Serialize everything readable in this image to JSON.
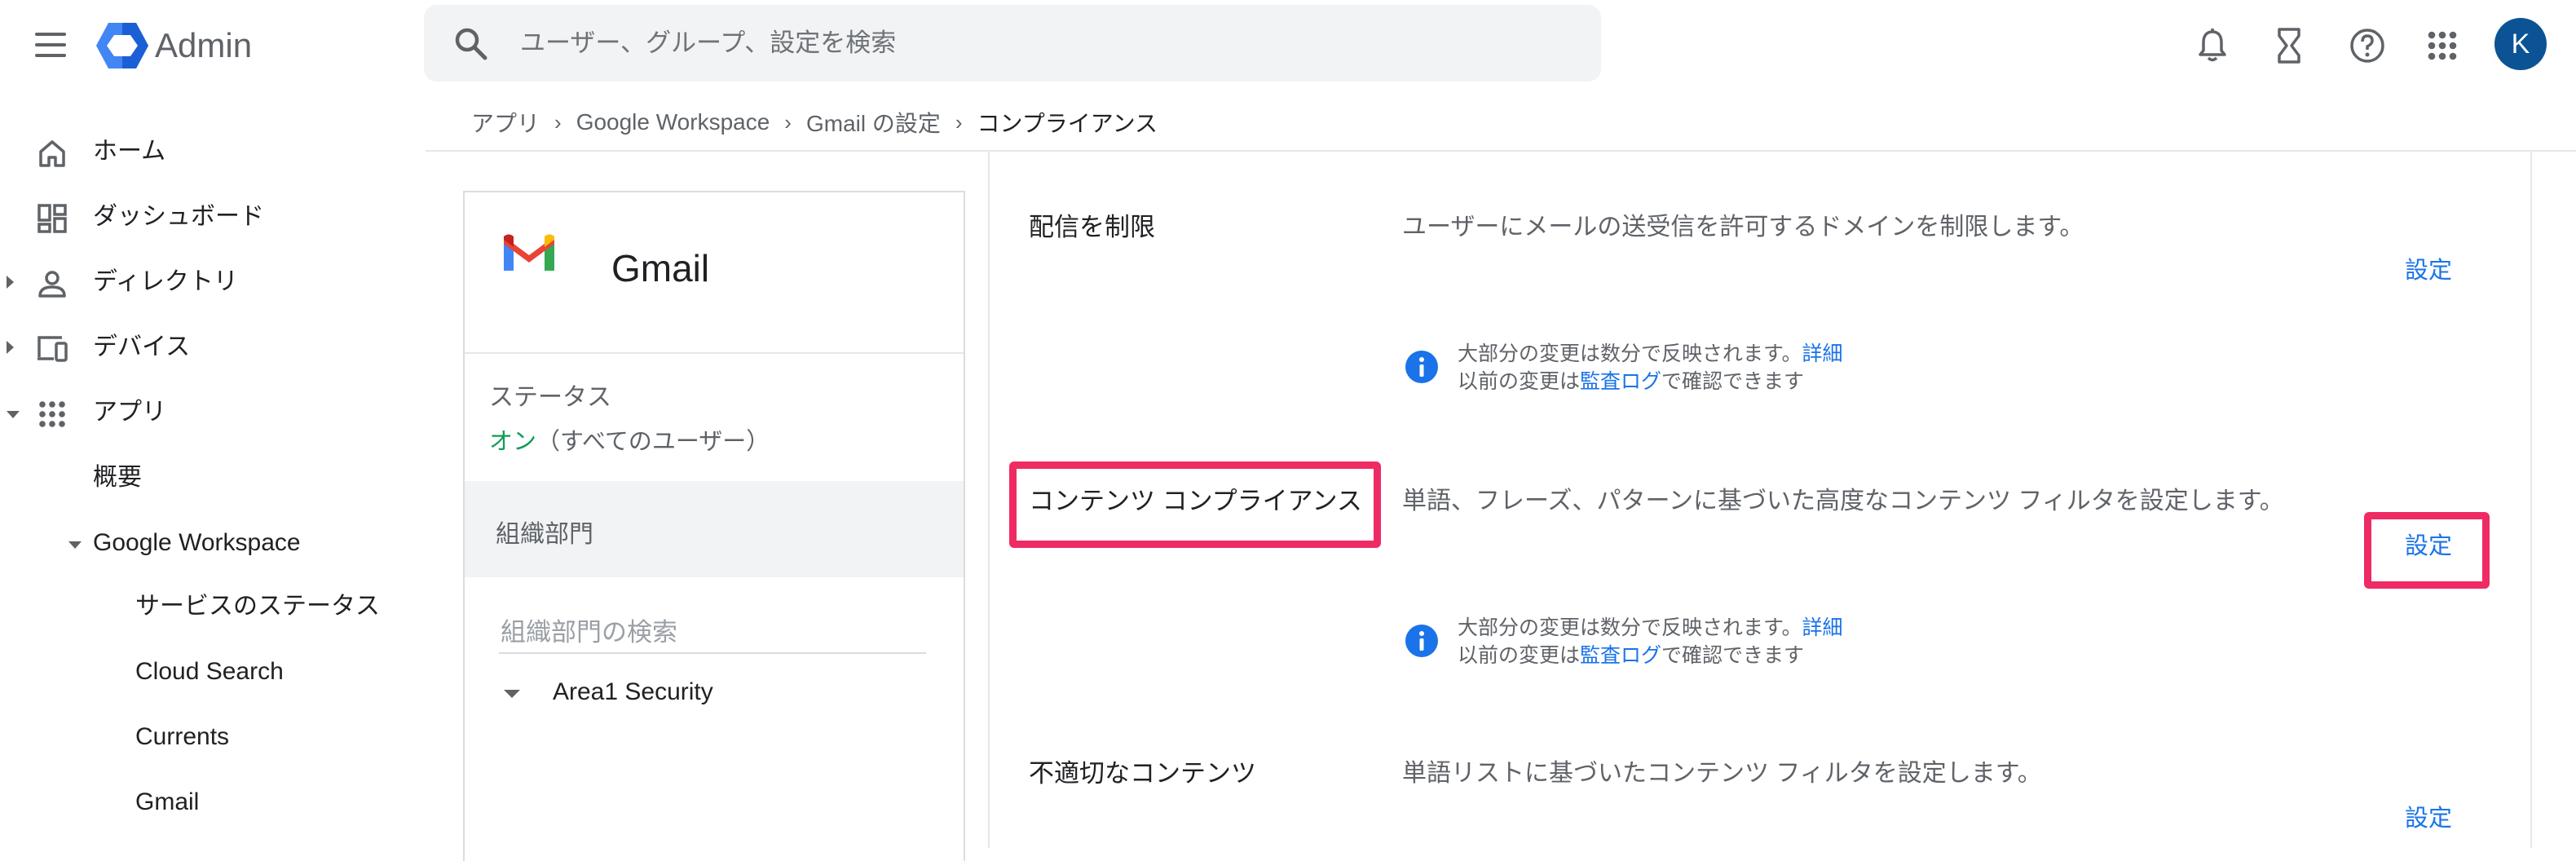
{
  "header": {
    "app_name": "Admin",
    "search_placeholder": "ユーザー、グループ、設定を検索",
    "avatar_initial": "K",
    "icons": [
      "menu-icon",
      "admin-logo-icon",
      "search-icon",
      "bell-icon",
      "hourglass-icon",
      "help-icon",
      "apps-grid-icon"
    ]
  },
  "breadcrumb": {
    "items": [
      "アプリ",
      "Google Workspace",
      "Gmail の設定"
    ],
    "current": "コンプライアンス"
  },
  "sidebar": {
    "items": [
      {
        "label": "ホーム",
        "icon": "home-icon"
      },
      {
        "label": "ダッシュボード",
        "icon": "dashboard-icon"
      },
      {
        "label": "ディレクトリ",
        "icon": "person-icon"
      },
      {
        "label": "デバイス",
        "icon": "devices-icon"
      },
      {
        "label": "アプリ",
        "icon": "apps-icon"
      },
      {
        "label": "概要"
      },
      {
        "label": "Google Workspace"
      },
      {
        "label": "サービスのステータス"
      },
      {
        "label": "Cloud Search"
      },
      {
        "label": "Currents"
      },
      {
        "label": "Gmail"
      }
    ]
  },
  "app_card": {
    "title": "Gmail",
    "status_label": "ステータス",
    "status_on": "オン",
    "status_scope": "（すべてのユーザー）",
    "org_units_header": "組織部門",
    "org_search_placeholder": "組織部門の検索",
    "org_item": "Area1 Security"
  },
  "settings": {
    "info_line1": "大部分の変更は数分で反映されます。",
    "info_link1": "詳細",
    "info_line2_prefix": "以前の変更は",
    "info_link2": "監査ログ",
    "info_line2_suffix": "で確認できます",
    "sections": [
      {
        "title": "配信を制限",
        "description": "ユーザーにメールの送受信を許可するドメインを制限します。",
        "button": "設定"
      },
      {
        "title": "コンテンツ コンプライアンス",
        "description": "単語、フレーズ、パターンに基づいた高度なコンテンツ フィルタを設定します。",
        "button": "設定"
      },
      {
        "title": "不適切なコンテンツ",
        "description": "単語リストに基づいたコンテンツ フィルタを設定します。",
        "button": "設定"
      }
    ]
  },
  "colors": {
    "accent_blue": "#1a73e8",
    "status_green": "#0f9d58",
    "highlight_pink": "#ef2b64",
    "avatar_bg": "#0b5394"
  }
}
